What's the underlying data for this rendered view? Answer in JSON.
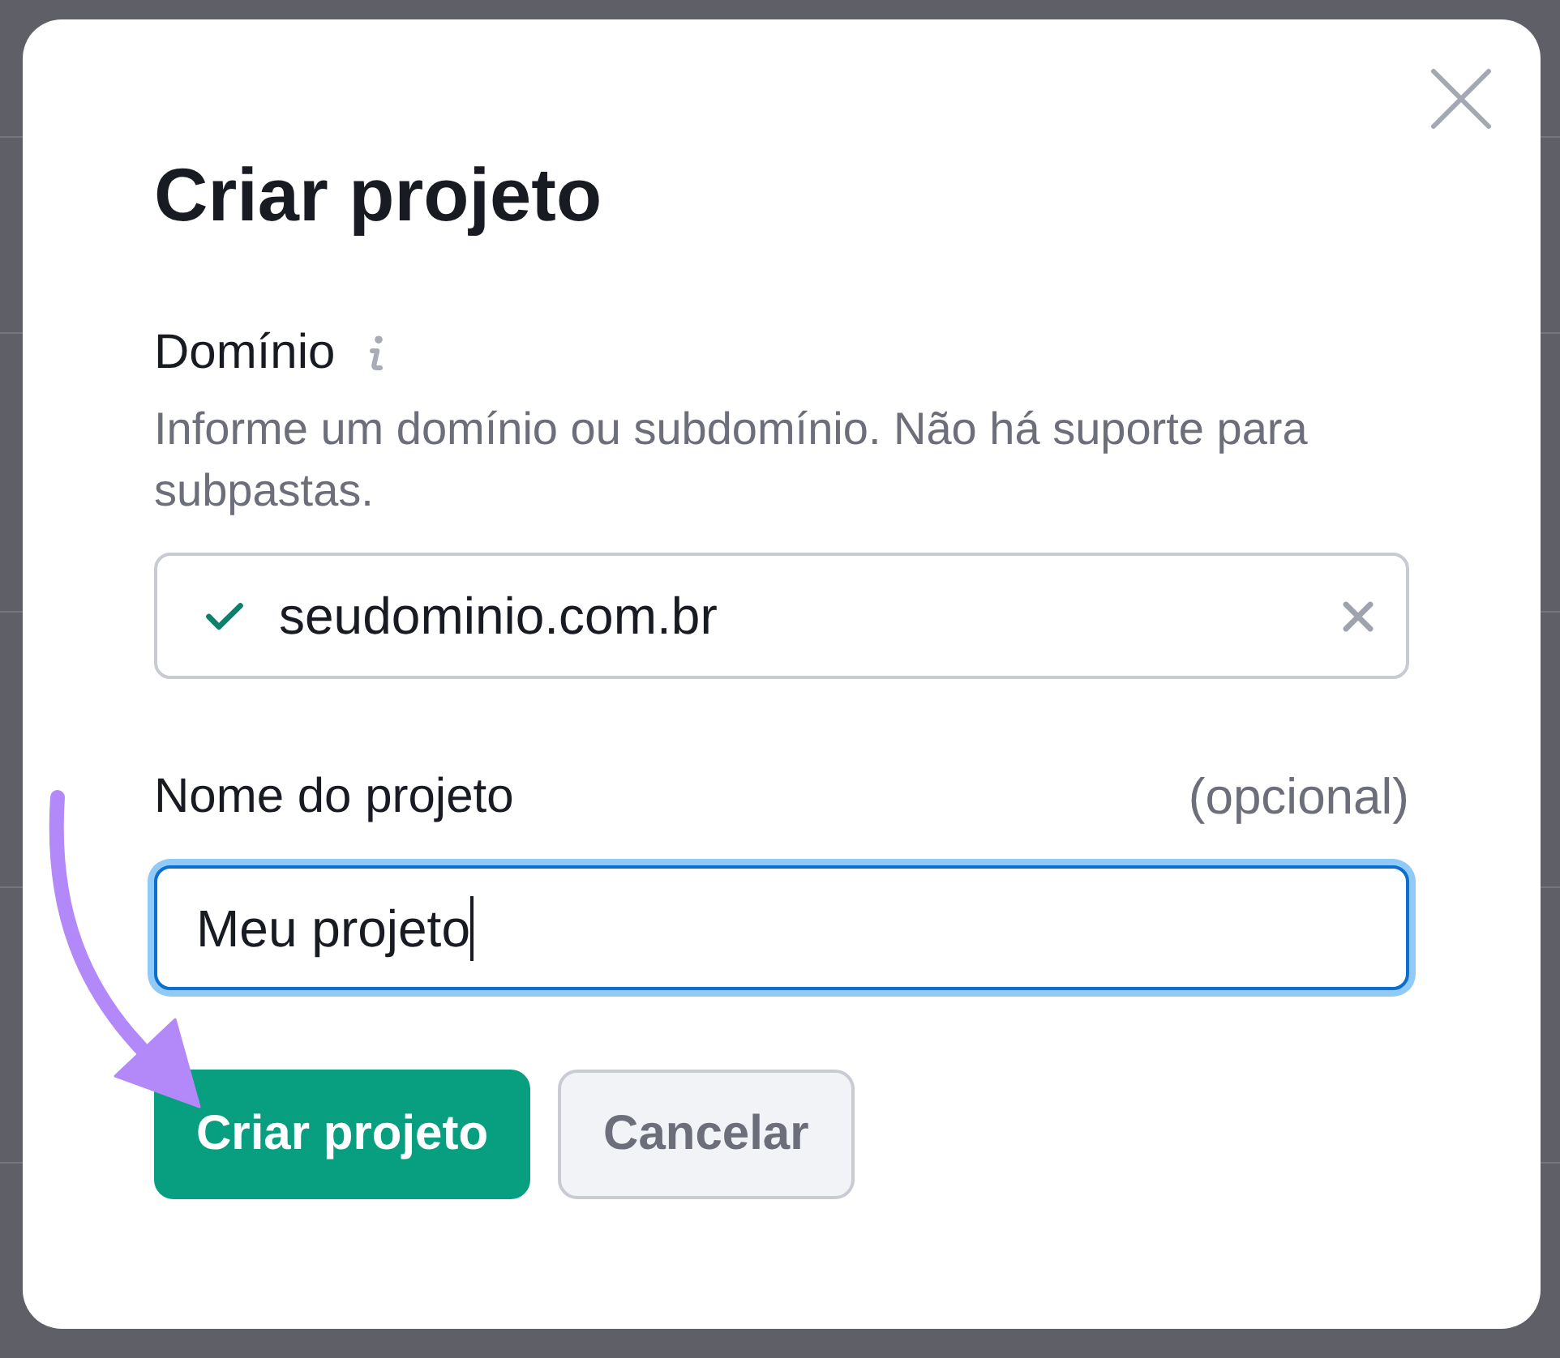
{
  "dialog": {
    "title": "Criar projeto",
    "domain_field": {
      "label": "Domínio",
      "hint": "Informe um domínio ou subdomínio. Não há suporte para subpastas.",
      "value": "seudominio.com.br",
      "valid": true
    },
    "name_field": {
      "label": "Nome do projeto",
      "optional_note": "(opcional)",
      "value": "Meu projeto",
      "focused": true
    },
    "buttons": [
      {
        "label": "Criar projeto",
        "kind": "primary"
      },
      {
        "label": "Cancelar",
        "kind": "secondary"
      }
    ]
  }
}
